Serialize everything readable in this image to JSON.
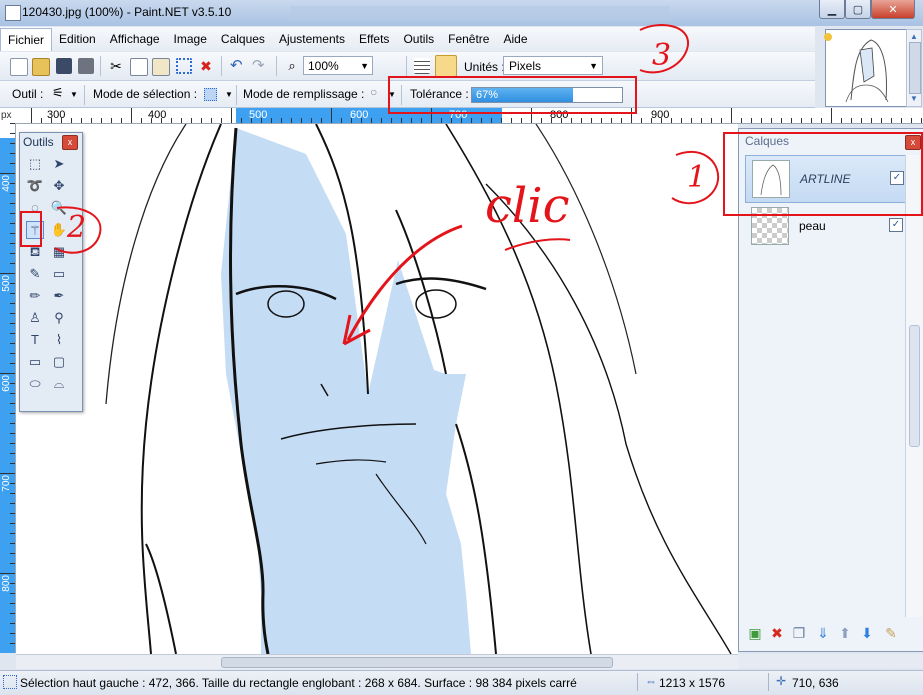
{
  "window": {
    "title": "120430.jpg (100%) - Paint.NET v3.5.10",
    "minimize": "▁",
    "maximize": "▢",
    "close": "✕",
    "background_tabs": [
      "...",
      "...",
      "..."
    ]
  },
  "menu": [
    "Fichier",
    "Edition",
    "Affichage",
    "Image",
    "Calques",
    "Ajustements",
    "Effets",
    "Outils",
    "Fenêtre",
    "Aide"
  ],
  "toolbar": {
    "icons": [
      "new-icon",
      "open-icon",
      "save-icon",
      "print-icon",
      "cut-icon",
      "copy-icon",
      "paste-icon",
      "crop-icon",
      "deselect-icon",
      "undo-icon",
      "redo-icon",
      "zoom-icon",
      "grid-icon",
      "ruler-icon"
    ],
    "zoom": "100%",
    "units_label": "Unités :",
    "units_value": "Pixels"
  },
  "toolbar2": {
    "tool_label": "Outil :",
    "selection_mode_label": "Mode de sélection :",
    "fill_mode_label": "Mode de remplissage :",
    "tolerance_label": "Tolérance :",
    "tolerance_value": "67%",
    "tolerance_fraction": 0.67
  },
  "rulers": {
    "unit": "px",
    "h_ticks": [
      "300",
      "400",
      "500",
      "600",
      "700",
      "800",
      "900"
    ],
    "v_ticks": [
      "400",
      "500",
      "600",
      "700",
      "800"
    ]
  },
  "tools_window": {
    "title": "Outils",
    "close": "x",
    "tools": [
      "rectangle-select-icon",
      "move-selection-icon",
      "lasso-select-icon",
      "move-selected-icon",
      "ellipse-select-icon",
      "zoom-tool-icon",
      "magic-wand-icon",
      "pan-icon",
      "paint-bucket-icon",
      "gradient-icon",
      "paintbrush-icon",
      "eraser-icon",
      "pencil-icon",
      "color-picker-icon",
      "clone-stamp-icon",
      "recolor-icon",
      "text-icon",
      "line-curve-icon",
      "rectangle-icon",
      "rounded-rectangle-icon",
      "ellipse-icon",
      "freeform-shape-icon"
    ],
    "selected": "magic-wand-icon"
  },
  "layers": {
    "title": "Calques",
    "close": "x",
    "items": [
      {
        "name": "ARTLINE",
        "checked": "✓",
        "selected": true
      },
      {
        "name": "peau",
        "checked": "✓",
        "selected": false
      }
    ],
    "buttons": [
      "add-layer-icon",
      "delete-layer-icon",
      "duplicate-layer-icon",
      "merge-down-icon",
      "move-up-icon",
      "move-down-icon",
      "layer-properties-icon"
    ]
  },
  "annotations": {
    "step1": "1",
    "step2": "2",
    "step3": "3",
    "clic": "clic"
  },
  "status": {
    "selection_info": "Sélection haut gauche : 472, 366. Taille du rectangle englobant : 268 x 684. Surface : 98 384 pixels carré",
    "image_size": "1213 x 1576",
    "cursor_pos": "710, 636"
  },
  "colors": {
    "accent": "#3da0f0",
    "selection_fill": "#c5dcf5",
    "annotation_red": "#e3141a",
    "layer_selected": "#c4daf3"
  }
}
